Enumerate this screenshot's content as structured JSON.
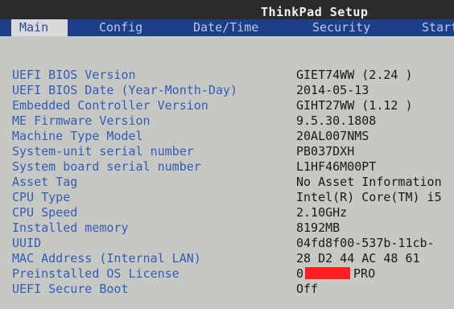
{
  "header": {
    "title": "ThinkPad Setup",
    "tabs": [
      {
        "label": "Main"
      },
      {
        "label": "Config"
      },
      {
        "label": "Date/Time"
      },
      {
        "label": "Security"
      },
      {
        "label": "Start"
      }
    ]
  },
  "main": {
    "rows": [
      {
        "label": "UEFI BIOS Version",
        "value": "GIET74WW (2.24 )"
      },
      {
        "label": "UEFI BIOS Date (Year-Month-Day)",
        "value": "2014-05-13"
      },
      {
        "label": "Embedded Controller Version",
        "value": "GIHT27WW (1.12 )"
      },
      {
        "label": "ME Firmware Version",
        "value": "9.5.30.1808"
      },
      {
        "label": "Machine Type Model",
        "value": "20AL007NMS"
      },
      {
        "label": "System-unit serial number",
        "value": "PB037DXH"
      },
      {
        "label": "System board serial number",
        "value": "L1HF46M00PT"
      },
      {
        "label": "Asset Tag",
        "value": "No Asset Information"
      },
      {
        "label": "CPU Type",
        "value": "Intel(R) Core(TM) i5"
      },
      {
        "label": "CPU Speed",
        "value": "2.10GHz"
      },
      {
        "label": "Installed memory",
        "value": "8192MB"
      },
      {
        "label": "UUID",
        "value": "04fd8f00-537b-11cb-"
      },
      {
        "label": "MAC Address (Internal LAN)",
        "value": "28 D2 44 AC 48 61"
      },
      {
        "label": "Preinstalled OS License",
        "value_prefix": "0",
        "value_suffix": "PRO"
      },
      {
        "label": "UEFI Secure Boot",
        "value": "Off"
      }
    ]
  },
  "colors": {
    "title_bar": "#2a2a2a",
    "tab_bar": "#1d3f88",
    "active_tab_bg": "#d8dadb",
    "label_text": "#355bb5",
    "value_text": "#1a1a1a",
    "redaction": "#ff1f1f"
  }
}
